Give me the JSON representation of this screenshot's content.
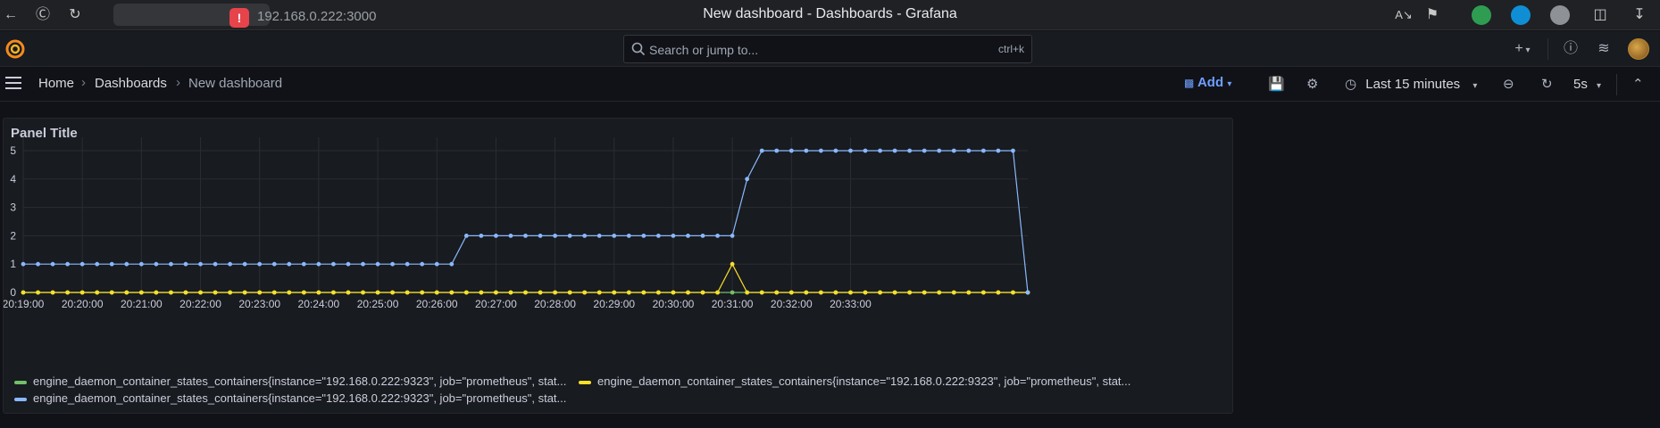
{
  "browser": {
    "url": "192.168.0.222:3000",
    "window_title": "New dashboard - Dashboards - Grafana"
  },
  "topbar": {
    "search_placeholder": "Search or jump to...",
    "search_shortcut": "ctrl+k",
    "new_icon": "+"
  },
  "navbar": {
    "breadcrumbs": [
      "Home",
      "Dashboards",
      "New dashboard"
    ],
    "add_label": "Add",
    "time_range": "Last 15 minutes",
    "refresh_interval": "5s"
  },
  "panel": {
    "title": "Panel Title"
  },
  "colors": {
    "green": "#73bf69",
    "yellow": "#fade2a",
    "blue": "#8ab8ff",
    "accent": "#6e9fff"
  },
  "chart_data": {
    "type": "line",
    "ylim": [
      0,
      5
    ],
    "yticks": [
      "0",
      "1",
      "2",
      "3",
      "4",
      "5"
    ],
    "xticks": [
      "20:19:00",
      "20:20:00",
      "20:21:00",
      "20:22:00",
      "20:23:00",
      "20:24:00",
      "20:25:00",
      "20:26:00",
      "20:27:00",
      "20:28:00",
      "20:29:00",
      "20:30:00",
      "20:31:00",
      "20:32:00",
      "20:33:00"
    ],
    "sample_interval_seconds": 15,
    "series": [
      {
        "name": "engine_daemon_container_states_containers{instance=\"192.168.0.222:9323\", job=\"prometheus\", stat...",
        "color": "#73bf69",
        "values": [
          0,
          0,
          0,
          0,
          0,
          0,
          0,
          0,
          0,
          0,
          0,
          0,
          0,
          0,
          0,
          0,
          0,
          0,
          0,
          0,
          0,
          0,
          0,
          0,
          0,
          0,
          0,
          0,
          0,
          0,
          0,
          0,
          0,
          0,
          0,
          0,
          0,
          0,
          0,
          0,
          0,
          0,
          0,
          0,
          0,
          0,
          0,
          0,
          0,
          0,
          0,
          0,
          0,
          0,
          0,
          0,
          0,
          0,
          0,
          0,
          0,
          0,
          0,
          0,
          0,
          0,
          0,
          0,
          0
        ]
      },
      {
        "name": "engine_daemon_container_states_containers{instance=\"192.168.0.222:9323\", job=\"prometheus\", stat...",
        "color": "#fade2a",
        "values": [
          0,
          0,
          0,
          0,
          0,
          0,
          0,
          0,
          0,
          0,
          0,
          0,
          0,
          0,
          0,
          0,
          0,
          0,
          0,
          0,
          0,
          0,
          0,
          0,
          0,
          0,
          0,
          0,
          0,
          0,
          0,
          0,
          0,
          0,
          0,
          0,
          0,
          0,
          0,
          0,
          0,
          0,
          0,
          0,
          0,
          0,
          0,
          0,
          1,
          0,
          0,
          0,
          0,
          0,
          0,
          0,
          0,
          0,
          0,
          0,
          0,
          0,
          0,
          0,
          0,
          0,
          0,
          0,
          0
        ]
      },
      {
        "name": "engine_daemon_container_states_containers{instance=\"192.168.0.222:9323\", job=\"prometheus\", stat...",
        "color": "#8ab8ff",
        "values": [
          1,
          1,
          1,
          1,
          1,
          1,
          1,
          1,
          1,
          1,
          1,
          1,
          1,
          1,
          1,
          1,
          1,
          1,
          1,
          1,
          1,
          1,
          1,
          1,
          1,
          1,
          1,
          1,
          1,
          1,
          2,
          2,
          2,
          2,
          2,
          2,
          2,
          2,
          2,
          2,
          2,
          2,
          2,
          2,
          2,
          2,
          2,
          2,
          2,
          4,
          5,
          5,
          5,
          5,
          5,
          5,
          5,
          5,
          5,
          5,
          5,
          5,
          5,
          5,
          5,
          5,
          5,
          5,
          0
        ]
      }
    ]
  }
}
